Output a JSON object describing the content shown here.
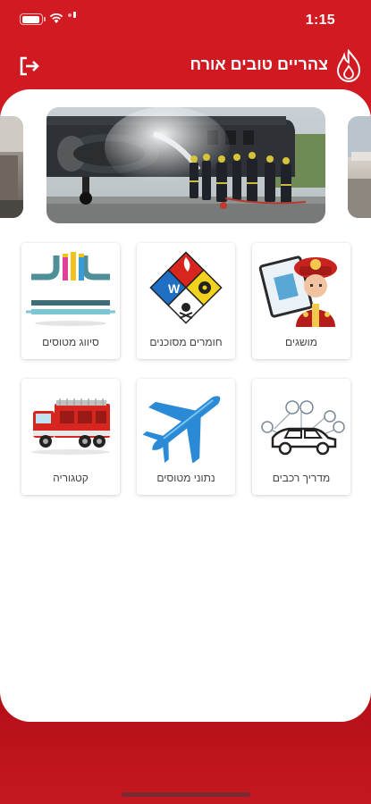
{
  "status_bar": {
    "time": "1:15",
    "icons": [
      "battery-icon",
      "wifi-icon",
      "cellular-signal-icon"
    ]
  },
  "header": {
    "title": "צהריים טובים אורח",
    "logout_icon": "logout-icon",
    "logo_icon": "flame-logo-icon"
  },
  "carousel": {
    "slides": [
      "slide-aircraft-firefighting",
      "slide-left-peek",
      "slide-right-peek"
    ]
  },
  "grid": {
    "row1": [
      {
        "label": "מושגים",
        "icon": "firefighter-manual-icon"
      },
      {
        "label": "חומרים מסוכנים",
        "icon": "hazmat-diamond-icon"
      },
      {
        "label": "סיווג מטוסים",
        "icon": "aircraft-classification-icon"
      }
    ],
    "row2": [
      {
        "label": "מדריך רכבים",
        "icon": "vehicle-guide-icon"
      },
      {
        "label": "נתוני מטוסים",
        "icon": "airplane-icon"
      },
      {
        "label": "קטגוריה",
        "icon": "fire-truck-icon"
      }
    ]
  },
  "colors": {
    "brand_red": "#d21a22",
    "card_bg": "#ffffff",
    "label_text": "#444444"
  }
}
